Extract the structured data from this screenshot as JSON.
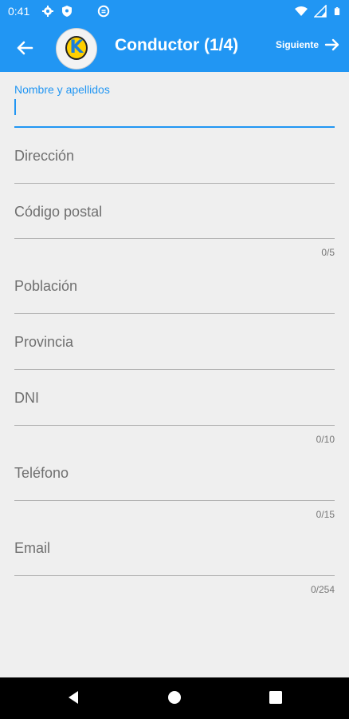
{
  "status_bar": {
    "time": "0:41",
    "icons_left": [
      "gear-icon",
      "shield-icon",
      "data-saver-icon"
    ],
    "icons_right": [
      "wifi-icon",
      "signal-icon",
      "battery-icon"
    ]
  },
  "app_bar": {
    "title": "Conductor (1/4)",
    "next_label": "Siguiente",
    "logo_letter": "K",
    "color": "#2196f3"
  },
  "form": {
    "fields": [
      {
        "label": "Nombre y apellidos",
        "value": "",
        "counter": "",
        "focused": true
      },
      {
        "label": "Dirección",
        "value": "",
        "counter": ""
      },
      {
        "label": "Código postal",
        "value": "",
        "counter": "0/5"
      },
      {
        "label": "Población",
        "value": "",
        "counter": ""
      },
      {
        "label": "Provincia",
        "value": "",
        "counter": ""
      },
      {
        "label": "DNI",
        "value": "",
        "counter": "0/10"
      },
      {
        "label": "Teléfono",
        "value": "",
        "counter": "0/15"
      },
      {
        "label": "Email",
        "value": "",
        "counter": "0/254"
      }
    ]
  },
  "nav_bar": {
    "buttons": [
      "back-triangle-icon",
      "home-circle-icon",
      "recents-square-icon"
    ]
  }
}
